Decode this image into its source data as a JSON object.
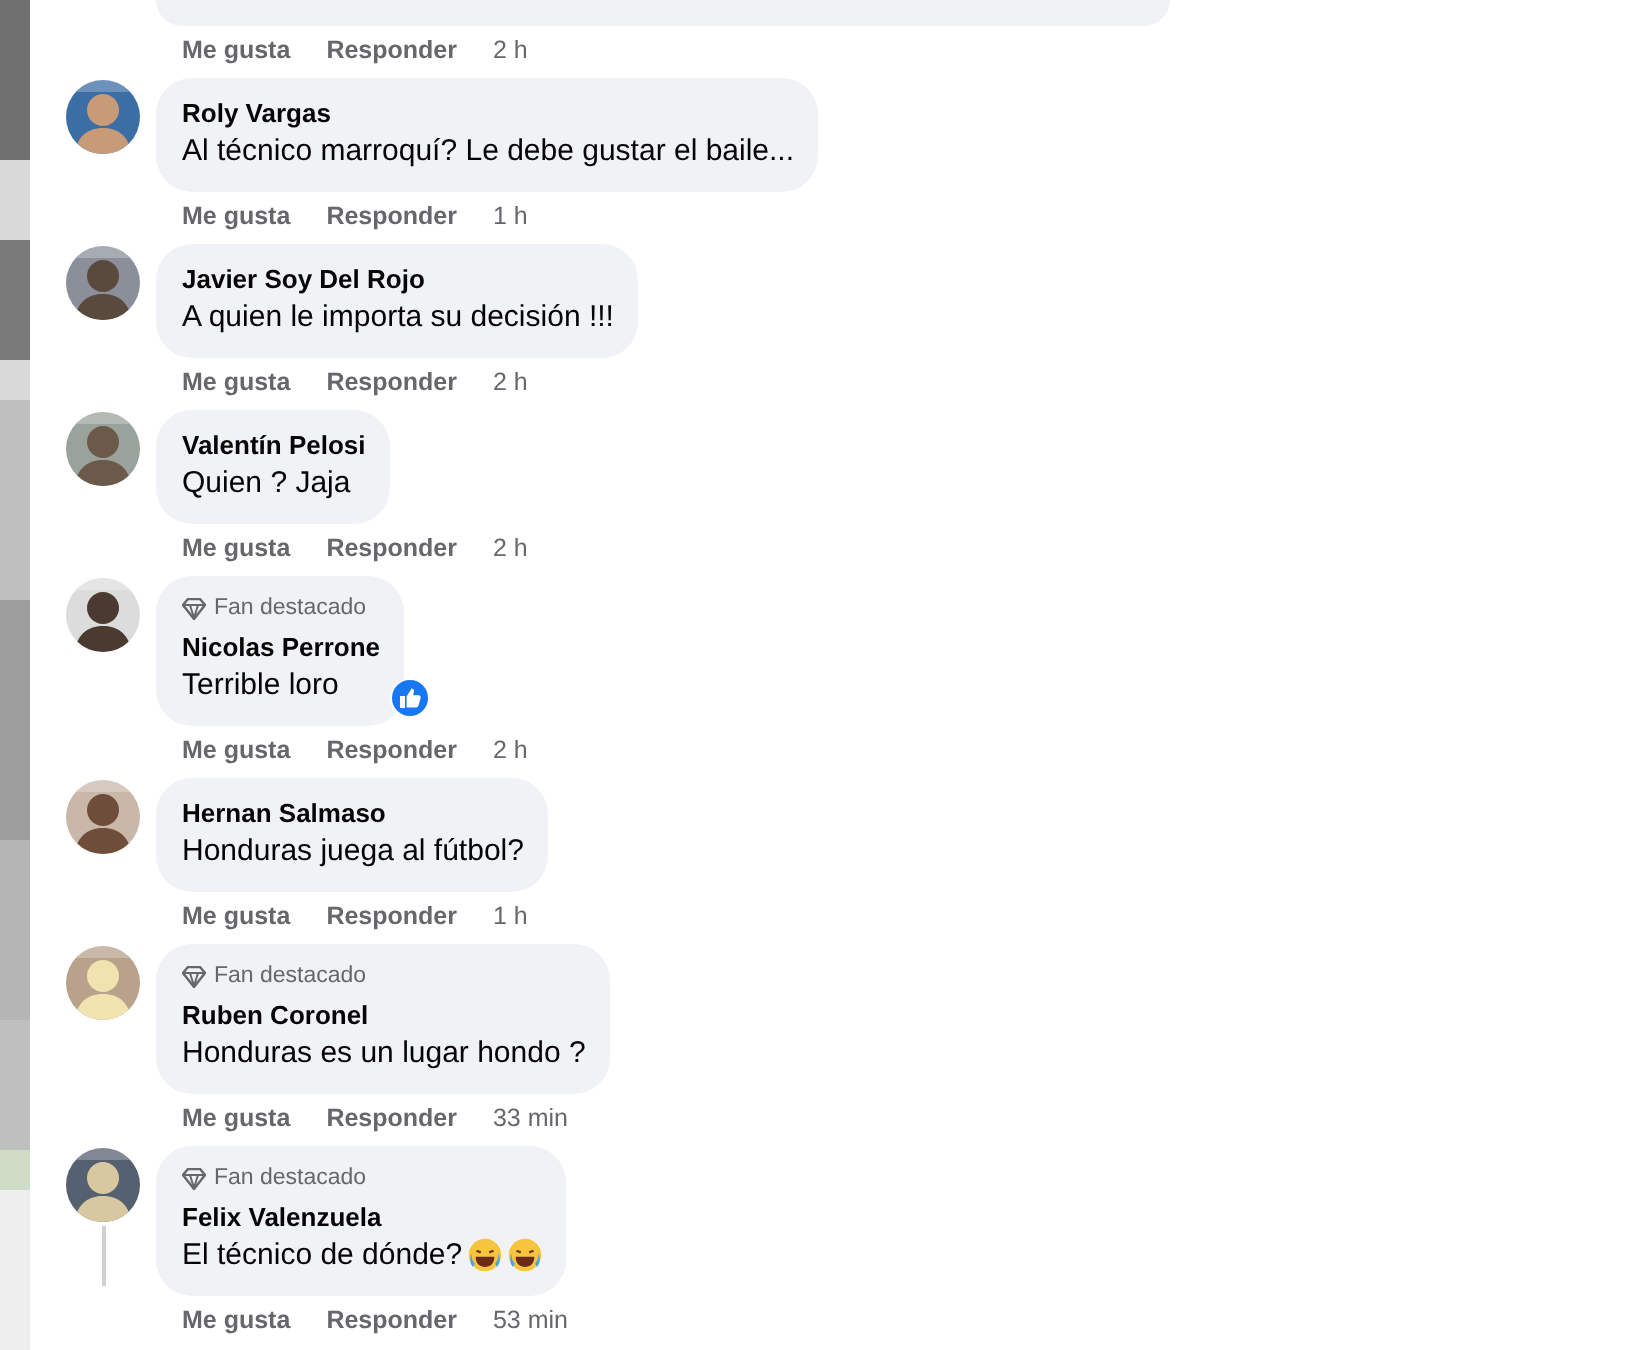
{
  "top_comment": {
    "actions": [
      "Me gusta",
      "Responder"
    ],
    "time": "2 h"
  },
  "comments": [
    {
      "author": "Roly Vargas",
      "text": "Al técnico marroquí? Le debe gustar el baile...",
      "actions": [
        "Me gusta",
        "Responder"
      ],
      "time": "1 h"
    },
    {
      "author": "Javier Soy Del Rojo",
      "text": "A quien le importa su decisión !!!",
      "actions": [
        "Me gusta",
        "Responder"
      ],
      "time": "2 h"
    },
    {
      "author": "Valentín Pelosi",
      "text": "Quien ? Jaja",
      "actions": [
        "Me gusta",
        "Responder"
      ],
      "time": "2 h"
    },
    {
      "badge": "Fan destacado",
      "author": "Nicolas Perrone",
      "text": "Terrible loro",
      "reaction": {
        "kind": "like"
      },
      "actions": [
        "Me gusta",
        "Responder"
      ],
      "time": "2 h"
    },
    {
      "author": "Hernan Salmaso",
      "text": "Honduras juega al fútbol?",
      "actions": [
        "Me gusta",
        "Responder"
      ],
      "time": "1 h"
    },
    {
      "badge": "Fan destacado",
      "author": "Ruben Coronel",
      "text": "Honduras es un lugar hondo ?",
      "actions": [
        "Me gusta",
        "Responder"
      ],
      "time": "33 min"
    },
    {
      "badge": "Fan destacado",
      "author": "Felix Valenzuela",
      "text": "El técnico de dónde?",
      "inline_emojis": [
        {
          "kind": "laughing"
        },
        {
          "kind": "laughing"
        }
      ],
      "actions": [
        "Me gusta",
        "Responder"
      ],
      "time": "53 min",
      "has_replies": true
    }
  ]
}
